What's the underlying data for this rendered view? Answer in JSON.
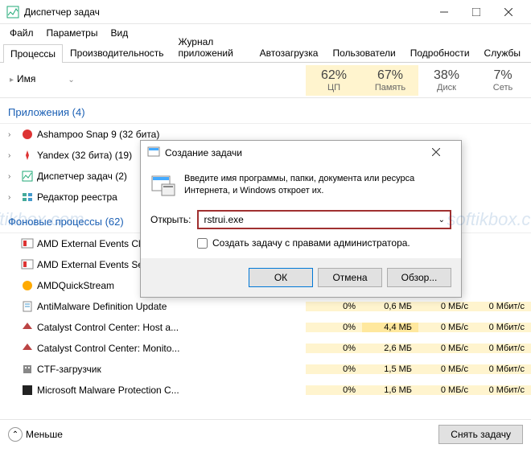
{
  "window": {
    "title": "Диспетчер задач",
    "minimize": "—",
    "maximize": "☐",
    "close": "✕"
  },
  "menu": {
    "file": "Файл",
    "options": "Параметры",
    "view": "Вид"
  },
  "tabs": {
    "processes": "Процессы",
    "performance": "Производительность",
    "app_history": "Журнал приложений",
    "startup": "Автозагрузка",
    "users": "Пользователи",
    "details": "Подробности",
    "services": "Службы"
  },
  "columns": {
    "name": "Имя",
    "cpu": {
      "pct": "62%",
      "label": "ЦП"
    },
    "mem": {
      "pct": "67%",
      "label": "Память"
    },
    "disk": {
      "pct": "38%",
      "label": "Диск"
    },
    "net": {
      "pct": "7%",
      "label": "Сеть"
    }
  },
  "groups": {
    "apps": "Приложения (4)",
    "bg": "Фоновые процессы (62)"
  },
  "apps": [
    {
      "icon": "snap",
      "name": "Ashampoo Snap 9 (32 бита)",
      "expand": true
    },
    {
      "icon": "yandex",
      "name": "Yandex (32 бита) (19)",
      "expand": true
    },
    {
      "icon": "tm",
      "name": "Диспетчер задач (2)",
      "expand": true
    },
    {
      "icon": "regedit",
      "name": "Редактор реестра",
      "expand": true
    }
  ],
  "bg": [
    {
      "icon": "amd",
      "name": "AMD External Events Client Module",
      "cpu": "",
      "mem": "",
      "disk": "",
      "net": ""
    },
    {
      "icon": "amd",
      "name": "AMD External Events Service Module",
      "cpu": "",
      "mem": "",
      "disk": "",
      "net": ""
    },
    {
      "icon": "amdq",
      "name": "AMDQuickStream",
      "cpu": "",
      "mem": "",
      "disk": "",
      "net": ""
    },
    {
      "icon": "shield",
      "name": "AntiMalware Definition Update",
      "cpu": "0%",
      "mem": "0,6 МБ",
      "disk": "0 МБ/с",
      "net": "0 Мбит/с"
    },
    {
      "icon": "ccc",
      "name": "Catalyst Control Center: Host a...",
      "cpu": "0%",
      "mem": "4,4 МБ",
      "disk": "0 МБ/с",
      "net": "0 Мбит/с"
    },
    {
      "icon": "ccc",
      "name": "Catalyst Control Center: Monito...",
      "cpu": "0%",
      "mem": "2,6 МБ",
      "disk": "0 МБ/с",
      "net": "0 Мбит/с"
    },
    {
      "icon": "ctf",
      "name": "CTF-загрузчик",
      "cpu": "0%",
      "mem": "1,5 МБ",
      "disk": "0 МБ/с",
      "net": "0 Мбит/с"
    },
    {
      "icon": "msmp",
      "name": "Microsoft Malware Protection C...",
      "cpu": "0%",
      "mem": "1,6 МБ",
      "disk": "0 МБ/с",
      "net": "0 Мбит/с"
    }
  ],
  "footer": {
    "fewer": "Меньше",
    "end_task": "Снять задачу"
  },
  "dialog": {
    "title": "Создание задачи",
    "prompt": "Введите имя программы, папки, документа или ресурса Интернета, и Windows откроет их.",
    "open_label": "Открыть:",
    "value": "rstrui.exe",
    "admin_label": "Создать задачу с правами администратора.",
    "ok": "ОК",
    "cancel": "Отмена",
    "browse": "Обзор...",
    "close": "✕"
  },
  "watermark": "softikbox.com"
}
